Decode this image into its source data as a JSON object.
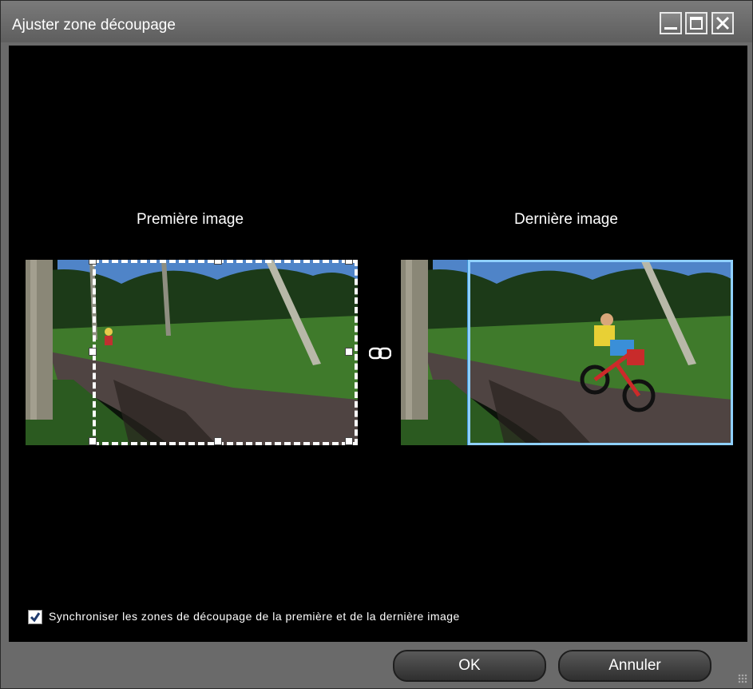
{
  "window": {
    "title": "Ajuster zone découpage",
    "controls": [
      "minimize-icon",
      "maximize-icon",
      "close-icon"
    ]
  },
  "panels": {
    "first": {
      "label": "Première image"
    },
    "last": {
      "label": "Dernière image"
    }
  },
  "link_icon": "link-icon",
  "sync": {
    "checked": true,
    "label": "Synchroniser les zones de découpage de la première et de la dernière image"
  },
  "buttons": {
    "ok": "OK",
    "cancel": "Annuler"
  },
  "colors": {
    "selection": "#8fd0ff",
    "background": "#000000",
    "chrome": "#6a6a6a"
  }
}
